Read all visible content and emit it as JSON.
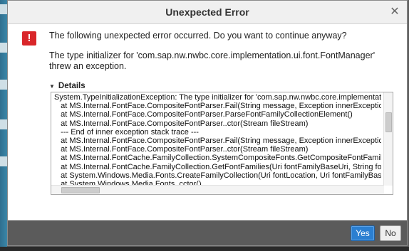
{
  "dialog": {
    "title": "Unexpected Error",
    "close_symbol": "✕",
    "icon": "error-icon",
    "icon_symbol": "!",
    "message_primary": "The following unexpected error occurred. Do you want to continue anyway?",
    "message_secondary": "The type initializer for 'com.sap.nw.nwbc.core.implementation.ui.font.FontManager' threw an exception.",
    "details_label": "Details",
    "details_lines": [
      "System.TypeInitializationException: The type initializer for 'com.sap.nw.nwbc.core.implementatio",
      "   at MS.Internal.FontFace.CompositeFontParser.Fail(String message, Exception innerExceptio",
      "   at MS.Internal.FontFace.CompositeFontParser.ParseFontFamilyCollectionElement()",
      "   at MS.Internal.FontFace.CompositeFontParser..ctor(Stream fileStream)",
      "   --- End of inner exception stack trace ---",
      "   at MS.Internal.FontFace.CompositeFontParser.Fail(String message, Exception innerExceptio",
      "   at MS.Internal.FontFace.CompositeFontParser..ctor(Stream fileStream)",
      "   at MS.Internal.FontCache.FamilyCollection.SystemCompositeFonts.GetCompositeFontFamily",
      "   at MS.Internal.FontCache.FamilyCollection.GetFontFamilies(Uri fontFamilyBaseUri, String fon",
      "   at System.Windows.Media.Fonts.CreateFamilyCollection(Uri fontLocation, Uri fontFamilyBase",
      "   at System.Windows.Media.Fonts..cctor()"
    ],
    "buttons": {
      "yes": "Yes",
      "no": "No"
    }
  },
  "colors": {
    "accent": "#2b7fd1",
    "error": "#d9262a",
    "footer": "#5b5b5b"
  }
}
